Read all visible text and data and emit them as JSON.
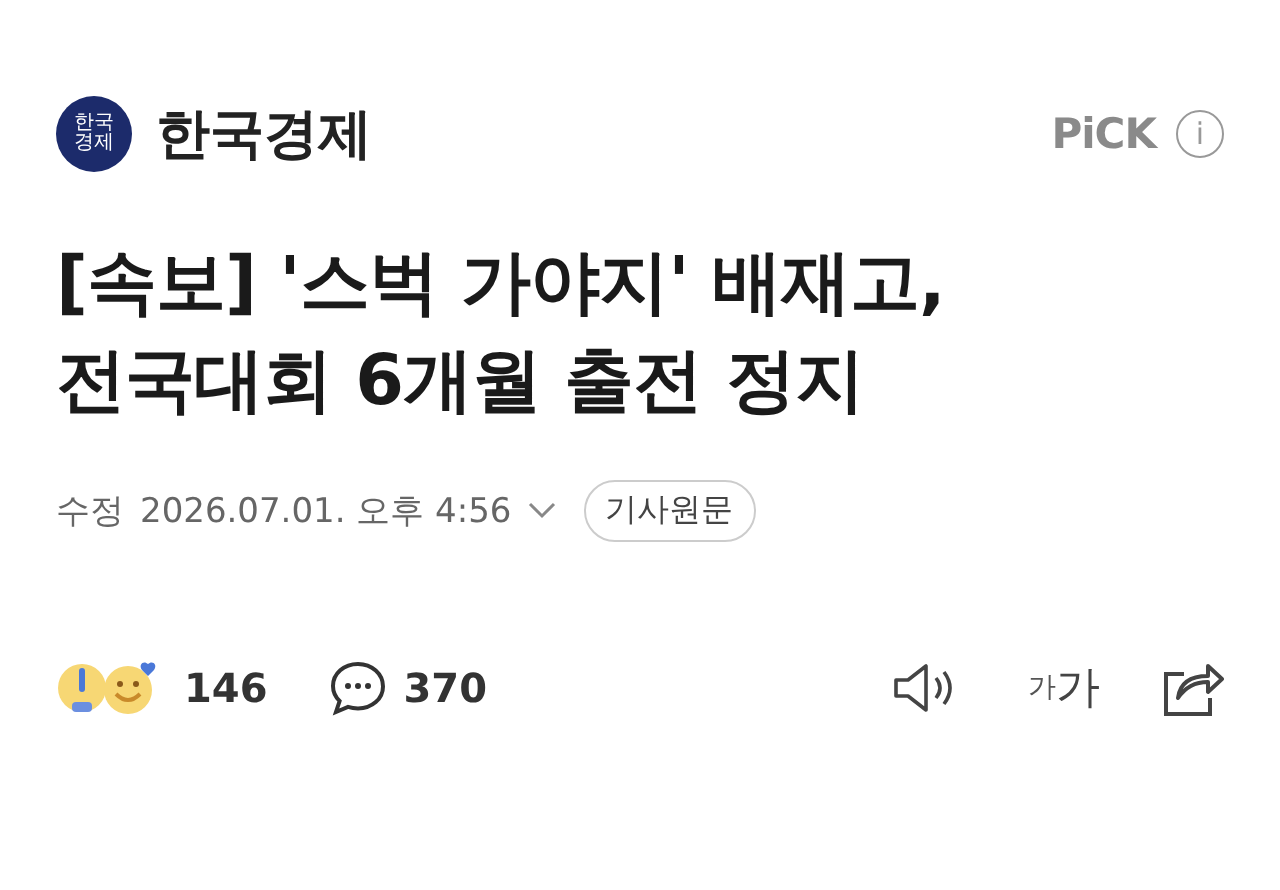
{
  "press": {
    "logo_text": "한국 경제",
    "name": "한국경제",
    "badge": "PiCK",
    "info": "i"
  },
  "headline": "[속보] '스벅 가야지' 배재고, 전국대회 6개월 출전 정지",
  "meta": {
    "label": "수정",
    "datetime": "2026.07.01. 오후 4:56",
    "source_button": "기사원문"
  },
  "actions": {
    "reaction_count": "146",
    "comment_count": "370",
    "font_small": "가",
    "font_large": "가"
  }
}
